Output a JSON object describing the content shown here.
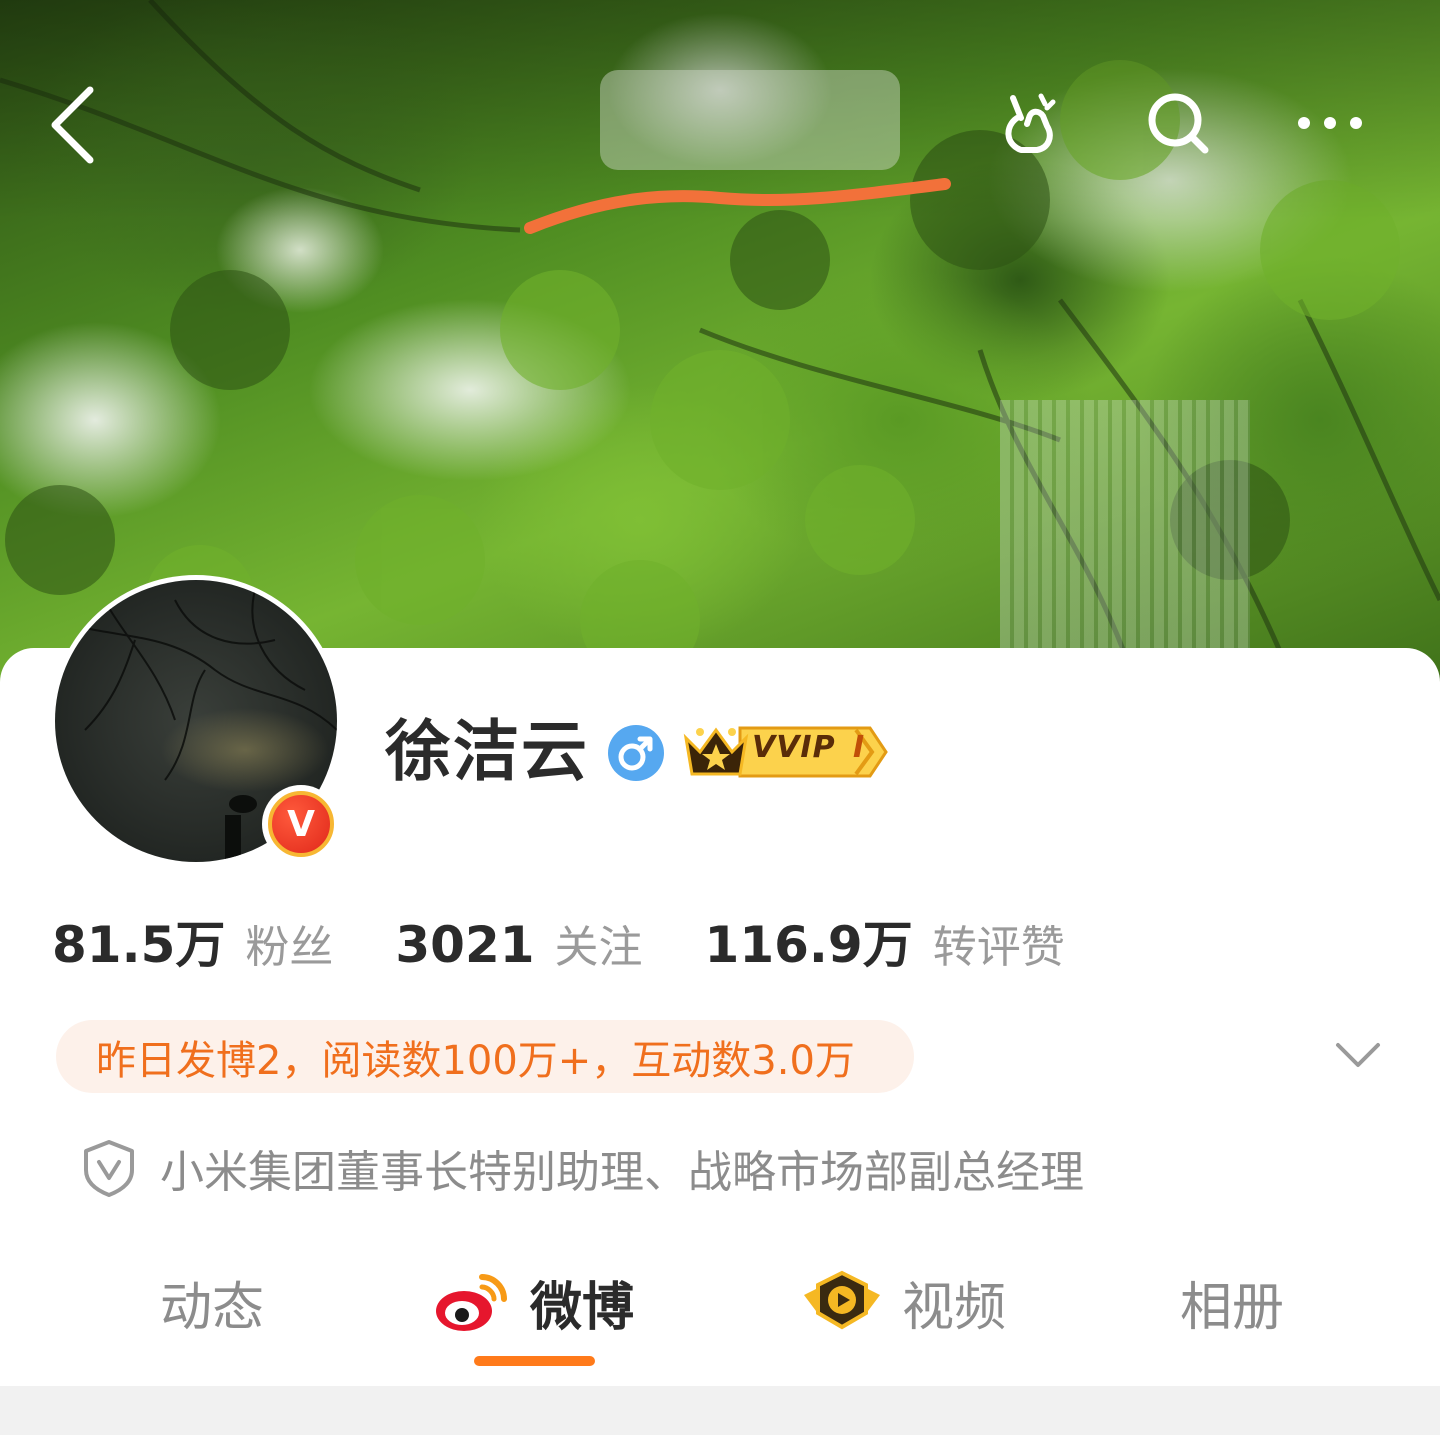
{
  "header": {
    "cover_image": "tree-canopy-cover-photo",
    "back_icon": "chevron-left-icon",
    "poke_icon": "poke-hand-icon",
    "search_icon": "search-icon",
    "more_icon": "more-dots-icon"
  },
  "profile": {
    "name": "徐洁云",
    "gender_icon": "male-icon",
    "vip_badge": "VVIP",
    "vip_level": "Ⅰ",
    "verified_badge": "V",
    "accent_color": "#ff7a1a"
  },
  "stats": [
    {
      "value": "81.5万",
      "label": "粉丝"
    },
    {
      "value": "3021",
      "label": "关注"
    },
    {
      "value": "116.9万",
      "label": "转评赞"
    }
  ],
  "activity_summary": "昨日发博2，阅读数100万+，互动数3.0万",
  "verification": "小米集团董事长特别助理、战略市场部副总经理",
  "tabs": [
    {
      "label": "动态",
      "active": false
    },
    {
      "label": "微博",
      "active": true
    },
    {
      "label": "视频",
      "active": false
    },
    {
      "label": "相册",
      "active": false
    }
  ]
}
